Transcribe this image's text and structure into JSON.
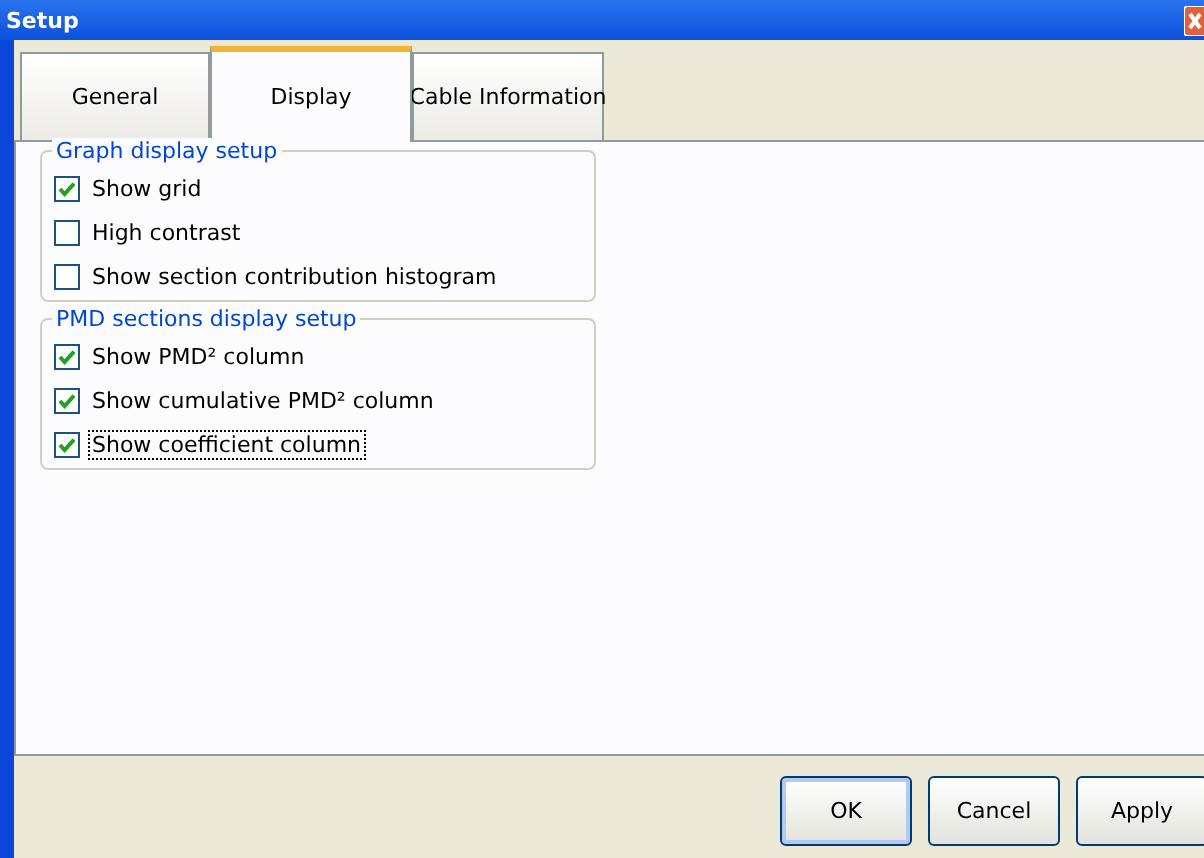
{
  "window": {
    "title": "Setup"
  },
  "tabs": [
    {
      "label": "General",
      "selected": false
    },
    {
      "label": "Display",
      "selected": true
    },
    {
      "label": "Cable Information",
      "selected": false
    }
  ],
  "groups": [
    {
      "title": "Graph display setup",
      "options": [
        {
          "label": "Show grid",
          "checked": true,
          "focused": false
        },
        {
          "label": "High contrast",
          "checked": false,
          "focused": false
        },
        {
          "label": "Show section contribution histogram",
          "checked": false,
          "focused": false
        }
      ]
    },
    {
      "title": "PMD sections display setup",
      "options": [
        {
          "label": "Show PMD² column",
          "checked": true,
          "focused": false
        },
        {
          "label": "Show cumulative PMD² column",
          "checked": true,
          "focused": false
        },
        {
          "label": "Show coefficient column",
          "checked": true,
          "focused": true
        }
      ]
    }
  ],
  "buttons": [
    {
      "label": "OK",
      "default": true
    },
    {
      "label": "Cancel",
      "default": false
    },
    {
      "label": "Apply",
      "default": false
    }
  ]
}
